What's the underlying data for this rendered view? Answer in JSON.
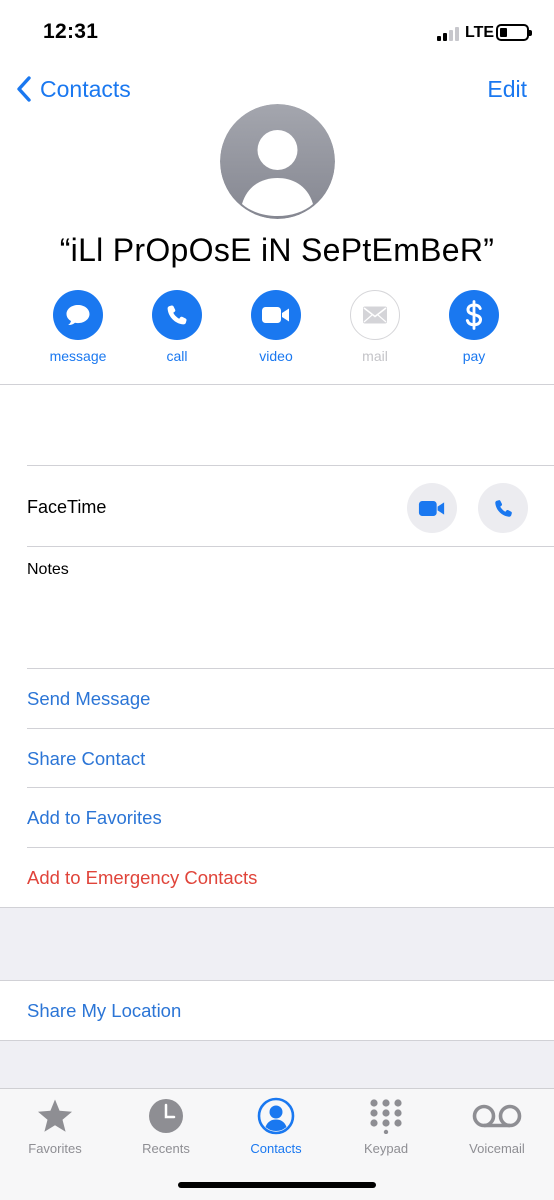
{
  "status": {
    "time": "12:31",
    "carrier": "LTE"
  },
  "nav": {
    "back_label": "Contacts",
    "edit_label": "Edit"
  },
  "contact": {
    "name": "“iLl PrOpOsE iN SePtEmBeR”"
  },
  "actions": [
    {
      "label": "message",
      "icon": "message-bubble-icon",
      "enabled": true
    },
    {
      "label": "call",
      "icon": "phone-icon",
      "enabled": true
    },
    {
      "label": "video",
      "icon": "video-camera-icon",
      "enabled": true
    },
    {
      "label": "mail",
      "icon": "envelope-icon",
      "enabled": false
    },
    {
      "label": "pay",
      "icon": "dollar-icon",
      "enabled": true
    }
  ],
  "facetime": {
    "label": "FaceTime"
  },
  "notes": {
    "label": "Notes",
    "value": ""
  },
  "links": {
    "send_message": "Send Message",
    "share_contact": "Share Contact",
    "add_favorites": "Add to Favorites",
    "add_emergency": "Add to Emergency Contacts",
    "share_location": "Share My Location"
  },
  "colors": {
    "accent": "#1a78f0",
    "destructive": "#e0443a",
    "grouped_background": "#efeff4"
  },
  "tabbar": [
    {
      "label": "Favorites",
      "icon": "star-icon",
      "active": false
    },
    {
      "label": "Recents",
      "icon": "clock-icon",
      "active": false
    },
    {
      "label": "Contacts",
      "icon": "person-circle-icon",
      "active": true
    },
    {
      "label": "Keypad",
      "icon": "keypad-icon",
      "active": false
    },
    {
      "label": "Voicemail",
      "icon": "voicemail-icon",
      "active": false
    }
  ]
}
